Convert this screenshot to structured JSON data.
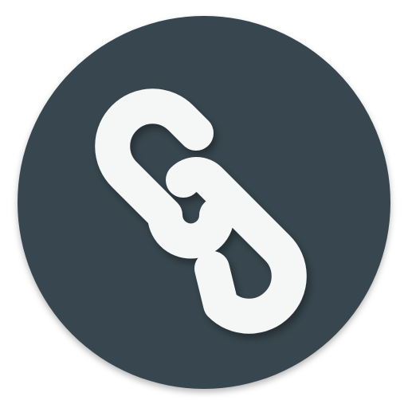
{
  "icon": {
    "name": "link-icon",
    "background_color": "#37474F",
    "glyph_color": "#F5F6F6",
    "shadow_color": "#1E282D"
  }
}
